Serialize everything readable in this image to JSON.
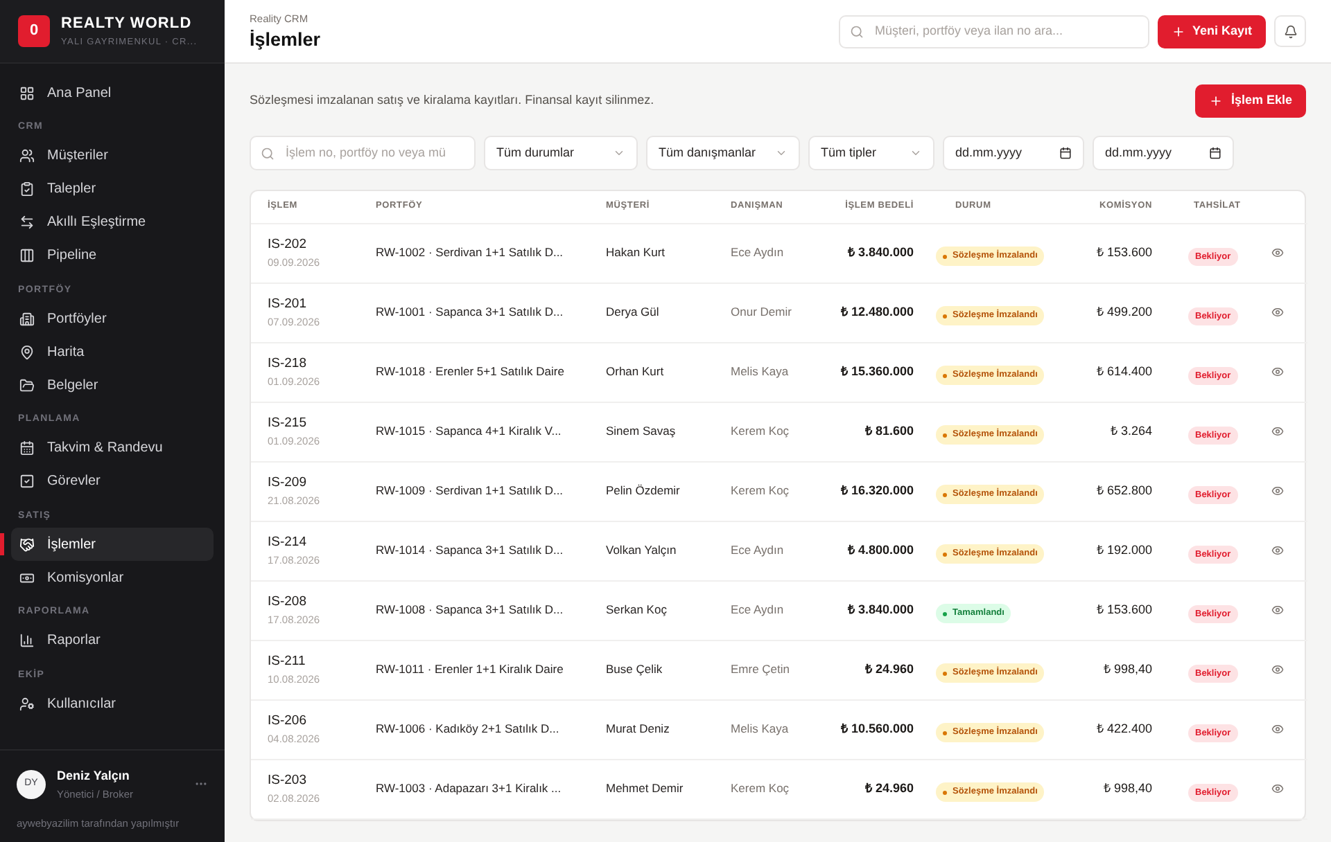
{
  "brand": {
    "logo": "0",
    "name": "REALTY WORLD",
    "subtitle": "YALI GAYRIMENKUL · CR..."
  },
  "sidebar": {
    "sections": [
      {
        "items": [
          {
            "label": "Ana Panel",
            "selected": false
          }
        ]
      },
      {
        "label": "CRM",
        "items": [
          {
            "label": "Müşteriler",
            "selected": false
          },
          {
            "label": "Talepler",
            "selected": false
          },
          {
            "label": "Akıllı Eşleştirme",
            "selected": false
          },
          {
            "label": "Pipeline",
            "selected": false
          }
        ]
      },
      {
        "label": "PORTFÖY",
        "items": [
          {
            "label": "Portföyler",
            "selected": false
          },
          {
            "label": "Harita",
            "selected": false
          },
          {
            "label": "Belgeler",
            "selected": false
          }
        ]
      },
      {
        "label": "PLANLAMA",
        "items": [
          {
            "label": "Takvim & Randevu",
            "selected": false
          },
          {
            "label": "Görevler",
            "selected": false
          }
        ]
      },
      {
        "label": "SATIŞ",
        "items": [
          {
            "label": "İşlemler",
            "selected": true
          },
          {
            "label": "Komisyonlar",
            "selected": false
          }
        ]
      },
      {
        "label": "RAPORLAMA",
        "items": [
          {
            "label": "Raporlar",
            "selected": false
          }
        ]
      },
      {
        "label": "EKİP",
        "items": [
          {
            "label": "Kullanıcılar",
            "selected": false
          }
        ]
      }
    ]
  },
  "user": {
    "initials": "DY",
    "name": "Deniz Yalçın",
    "role": "Yönetici / Broker",
    "credit": "aywebyazilim tarafından yapılmıştır"
  },
  "header": {
    "breadcrumb": "Reality CRM",
    "title": "İşlemler",
    "search_placeholder": "Müşteri, portföy veya ilan no ara...",
    "new_button": "Yeni Kayıt"
  },
  "page": {
    "description": "Sözleşmesi imzalanan satış ve kiralama kayıtları. Finansal kayıt silinmez.",
    "add_button": "İşlem Ekle"
  },
  "filters": {
    "search_placeholder": "İşlem no, portföy no veya mü",
    "selects": [
      "Tüm durumlar",
      "Tüm danışmanlar",
      "Tüm tipler"
    ],
    "dates": [
      "dd.mm.yyyy",
      "dd.mm.yyyy"
    ]
  },
  "table": {
    "columns": [
      "İŞLEM",
      "PORTFÖY",
      "MÜŞTERİ",
      "DANIŞMAN",
      "İŞLEM BEDELİ",
      "DURUM",
      "KOMİSYON",
      "TAHSİLAT"
    ],
    "rows": [
      {
        "id": "IS-202",
        "date": "09.09.2026",
        "portfolio": "RW-1002 · Serdivan 1+1 Satılık D...",
        "customer": "Hakan Kurt",
        "agent": "Ece Aydın",
        "amount": "₺ 3.840.000",
        "status": {
          "label": "Sözleşme İmzalandı",
          "kind": "signed"
        },
        "commission": "₺ 153.600",
        "collection": "Bekliyor"
      },
      {
        "id": "IS-201",
        "date": "07.09.2026",
        "portfolio": "RW-1001 · Sapanca 3+1 Satılık D...",
        "customer": "Derya Gül",
        "agent": "Onur Demir",
        "amount": "₺ 12.480.000",
        "status": {
          "label": "Sözleşme İmzalandı",
          "kind": "signed"
        },
        "commission": "₺ 499.200",
        "collection": "Bekliyor"
      },
      {
        "id": "IS-218",
        "date": "01.09.2026",
        "portfolio": "RW-1018 · Erenler 5+1 Satılık Daire",
        "customer": "Orhan Kurt",
        "agent": "Melis Kaya",
        "amount": "₺ 15.360.000",
        "status": {
          "label": "Sözleşme İmzalandı",
          "kind": "signed"
        },
        "commission": "₺ 614.400",
        "collection": "Bekliyor"
      },
      {
        "id": "IS-215",
        "date": "01.09.2026",
        "portfolio": "RW-1015 · Sapanca 4+1 Kiralık V...",
        "customer": "Sinem Savaş",
        "agent": "Kerem Koç",
        "amount": "₺ 81.600",
        "status": {
          "label": "Sözleşme İmzalandı",
          "kind": "signed"
        },
        "commission": "₺ 3.264",
        "collection": "Bekliyor"
      },
      {
        "id": "IS-209",
        "date": "21.08.2026",
        "portfolio": "RW-1009 · Serdivan 1+1 Satılık D...",
        "customer": "Pelin Özdemir",
        "agent": "Kerem Koç",
        "amount": "₺ 16.320.000",
        "status": {
          "label": "Sözleşme İmzalandı",
          "kind": "signed"
        },
        "commission": "₺ 652.800",
        "collection": "Bekliyor"
      },
      {
        "id": "IS-214",
        "date": "17.08.2026",
        "portfolio": "RW-1014 · Sapanca 3+1 Satılık D...",
        "customer": "Volkan Yalçın",
        "agent": "Ece Aydın",
        "amount": "₺ 4.800.000",
        "status": {
          "label": "Sözleşme İmzalandı",
          "kind": "signed"
        },
        "commission": "₺ 192.000",
        "collection": "Bekliyor"
      },
      {
        "id": "IS-208",
        "date": "17.08.2026",
        "portfolio": "RW-1008 · Sapanca 3+1 Satılık D...",
        "customer": "Serkan Koç",
        "agent": "Ece Aydın",
        "amount": "₺ 3.840.000",
        "status": {
          "label": "Tamamlandı",
          "kind": "completed"
        },
        "commission": "₺ 153.600",
        "collection": "Bekliyor"
      },
      {
        "id": "IS-211",
        "date": "10.08.2026",
        "portfolio": "RW-1011 · Erenler 1+1 Kiralık Daire",
        "customer": "Buse Çelik",
        "agent": "Emre Çetin",
        "amount": "₺ 24.960",
        "status": {
          "label": "Sözleşme İmzalandı",
          "kind": "signed"
        },
        "commission": "₺ 998,40",
        "collection": "Bekliyor"
      },
      {
        "id": "IS-206",
        "date": "04.08.2026",
        "portfolio": "RW-1006 · Kadıköy 2+1 Satılık D...",
        "customer": "Murat Deniz",
        "agent": "Melis Kaya",
        "amount": "₺ 10.560.000",
        "status": {
          "label": "Sözleşme İmzalandı",
          "kind": "signed"
        },
        "commission": "₺ 422.400",
        "collection": "Bekliyor"
      },
      {
        "id": "IS-203",
        "date": "02.08.2026",
        "portfolio": "RW-1003 · Adapazarı 3+1 Kiralık ...",
        "customer": "Mehmet Demir",
        "agent": "Kerem Koç",
        "amount": "₺ 24.960",
        "status": {
          "label": "Sözleşme İmzalandı",
          "kind": "signed"
        },
        "commission": "₺ 998,40",
        "collection": "Bekliyor"
      }
    ]
  }
}
